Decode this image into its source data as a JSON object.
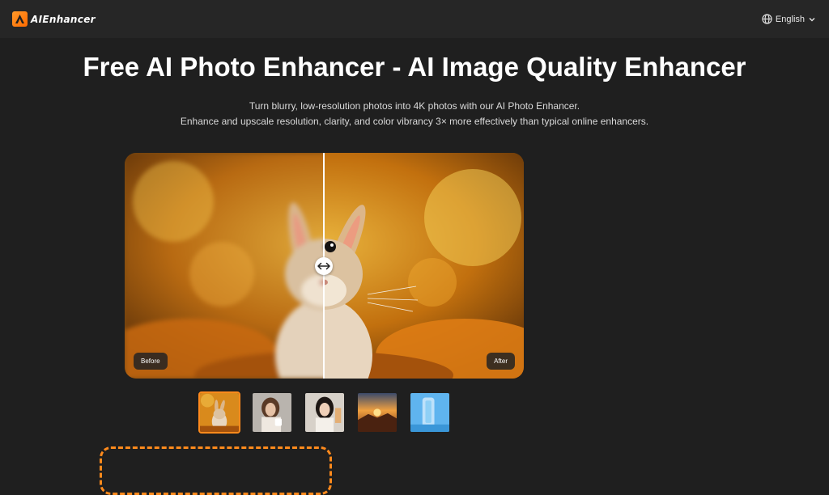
{
  "header": {
    "logo_text": "AIEnhancer",
    "language": "English"
  },
  "hero": {
    "title": "Free AI Photo Enhancer - AI Image Quality Enhancer",
    "subtitle_line1": "Turn blurry, low-resolution photos into 4K photos with our AI Photo Enhancer.",
    "subtitle_line2": "Enhance and upscale resolution, clarity, and color vibrancy 3× more effectively than typical online enhancers."
  },
  "compare": {
    "before_label": "Before",
    "after_label": "After"
  },
  "thumbnails": [
    {
      "name": "rabbit",
      "active": true
    },
    {
      "name": "woman-with-cup",
      "active": false
    },
    {
      "name": "woman-portrait",
      "active": false
    },
    {
      "name": "sunset-landscape",
      "active": false
    },
    {
      "name": "blue-product",
      "active": false
    }
  ],
  "colors": {
    "accent": "#ff8a1c",
    "background": "#1f1f1f",
    "header": "#262626"
  }
}
